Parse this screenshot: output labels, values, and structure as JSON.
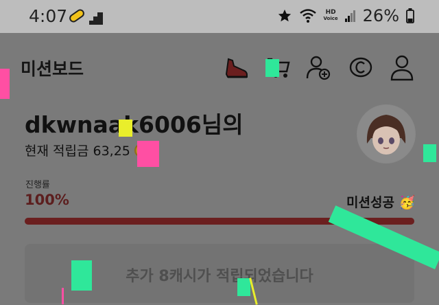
{
  "status_bar": {
    "time": "4:07",
    "hd_label": "HD",
    "voice_label": "Voice",
    "battery_percent": "26%"
  },
  "header": {
    "title": "미션보드",
    "icons": [
      "sneaker-icon",
      "cart-icon",
      "add-user-icon",
      "coin-icon",
      "profile-icon"
    ]
  },
  "user": {
    "name": "dkwnaak6006님의",
    "points_label": "현재 적립금 63,25",
    "coin_symbol": "C"
  },
  "progress": {
    "label": "진행률",
    "value_text": "100%",
    "fraction": 1.0,
    "status_text": "미션성공 🥳"
  },
  "banner": {
    "text": "추가 8캐시가 적립되었습니다"
  },
  "colors": {
    "overlay_bg": "#7a7a7a",
    "status_bar_bg": "#bdbdbd",
    "progress_fill": "#6b1f1f",
    "progress_track": "#5b5b5b",
    "coin": "#b8902a",
    "blob_green": "#2fe79a",
    "blob_pink": "#ff4fa3",
    "blob_yellow": "#e9ee2b"
  }
}
